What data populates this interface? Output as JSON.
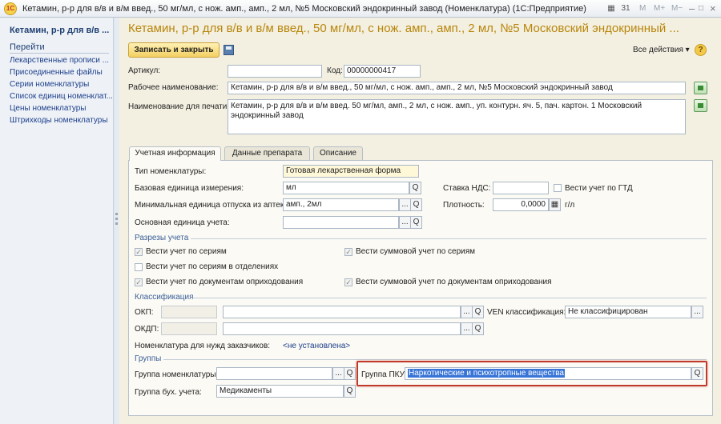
{
  "window": {
    "logo_text": "1C",
    "title": "Кетамин, р-р для в/в и в/м введ., 50 мг/мл, с нож. амп., амп., 2 мл, №5 Московский эндокринный завод (Номенклатура)  (1С:Предприятие)",
    "controls": {
      "m": "M",
      "m_plus": "M+",
      "m_minus": "M−",
      "minimize": "–",
      "maximize": "□",
      "close": "×"
    }
  },
  "sidebar": {
    "title": "Кетамин, р-р для в/в ...",
    "section": "Перейти",
    "items": [
      "Лекарственные прописи ...",
      "Присоединенные файлы",
      "Серии номенклатуры",
      "Список единиц номенклат...",
      "Цены номенклатуры",
      "Штрихкоды номенклатуры"
    ]
  },
  "header": {
    "title": "Кетамин, р-р для в/в и в/м введ., 50 мг/мл, с нож. амп., амп., 2 мл, №5 Московский эндокринный ...",
    "save_close": "Записать и закрыть",
    "all_actions": "Все действия ▾",
    "help": "?"
  },
  "form": {
    "article_label": "Артикул:",
    "article_value": "",
    "code_label": "Код:",
    "code_value": "00000000417",
    "work_name_label": "Рабочее наименование:",
    "work_name_value": "Кетамин, р-р для в/в и в/м введ., 50 мг/мл, с нож. амп., амп., 2 мл, №5 Московский эндокринный завод",
    "print_name_label": "Наименование для печати:",
    "print_name_value": "Кетамин, р-р для в/в и в/м введ. 50 мг/мл, амп., 2 мл, с нож. амп., уп. контурн. яч. 5, пач. картон. 1 Московский эндокринный завод"
  },
  "tabs": [
    "Учетная информация",
    "Данные препарата",
    "Описание"
  ],
  "accounting": {
    "nom_type_label": "Тип номенклатуры:",
    "nom_type_value": "Готовая лекарственная форма",
    "base_unit_label": "Базовая единица измерения:",
    "base_unit_value": "мл",
    "min_unit_label": "Минимальная единица отпуска из аптеки:",
    "min_unit_value": "амп., 2мл",
    "main_unit_label": "Основная единица учета:",
    "main_unit_value": "",
    "vat_label": "Ставка НДС:",
    "vat_value": "",
    "gtd_label": "Вести учет по ГТД",
    "density_label": "Плотность:",
    "density_value": "0,0000",
    "density_unit": "г/л"
  },
  "sections": {
    "breakdowns": "Разрезы учета",
    "classification": "Классификация",
    "groups": "Группы"
  },
  "checkboxes": {
    "series": "Вести учет по сериям",
    "sum_series": "Вести суммовой учет по сериям",
    "series_departments": "Вести учет по сериям в отделениях",
    "receipt_docs": "Вести учет по документам оприходования",
    "sum_receipt_docs": "Вести суммовой учет по документам оприходования"
  },
  "classification": {
    "okp_label": "ОКП:",
    "okdp_label": "ОКДП:",
    "ven_label": "VEN классификация:",
    "ven_value": "Не классифицирован",
    "customer_needs_label": "Номенклатура для нужд заказчиков:",
    "customer_needs_value": "<не установлена>"
  },
  "groups": {
    "nom_group_label": "Группа номенклатуры:",
    "nom_group_value": "",
    "pku_label": "Группа ПКУ:",
    "pku_value": "Наркотические и психотропные вещества",
    "accounting_group_label": "Группа бух. учета:",
    "accounting_group_value": "Медикаменты"
  },
  "icons": {
    "select_button": "...",
    "search_icon": "Q",
    "calculator_icon": "▦",
    "check_mark": "✓"
  }
}
